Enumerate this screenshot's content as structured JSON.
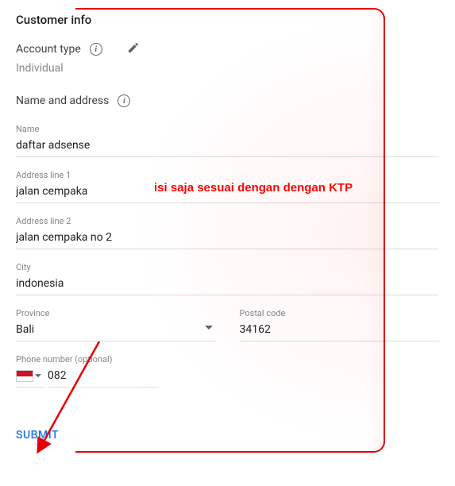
{
  "section_title": "Customer info",
  "account_type": {
    "label": "Account type",
    "value": "Individual"
  },
  "name_address": {
    "header": "Name and address",
    "name": {
      "label": "Name",
      "value": "daftar adsense"
    },
    "address1": {
      "label": "Address line 1",
      "value": "jalan cempaka"
    },
    "address2": {
      "label": "Address line 2",
      "value": "jalan cempaka no 2"
    },
    "city": {
      "label": "City",
      "value": "indonesia"
    },
    "province": {
      "label": "Province",
      "value": "Bali"
    },
    "postal": {
      "label": "Postal code",
      "value": "34162"
    },
    "phone": {
      "label": "Phone number (optional)",
      "value": "082"
    }
  },
  "submit_label": "SUBMIT",
  "annotation": "isi saja sesuai dengan dengan KTP"
}
